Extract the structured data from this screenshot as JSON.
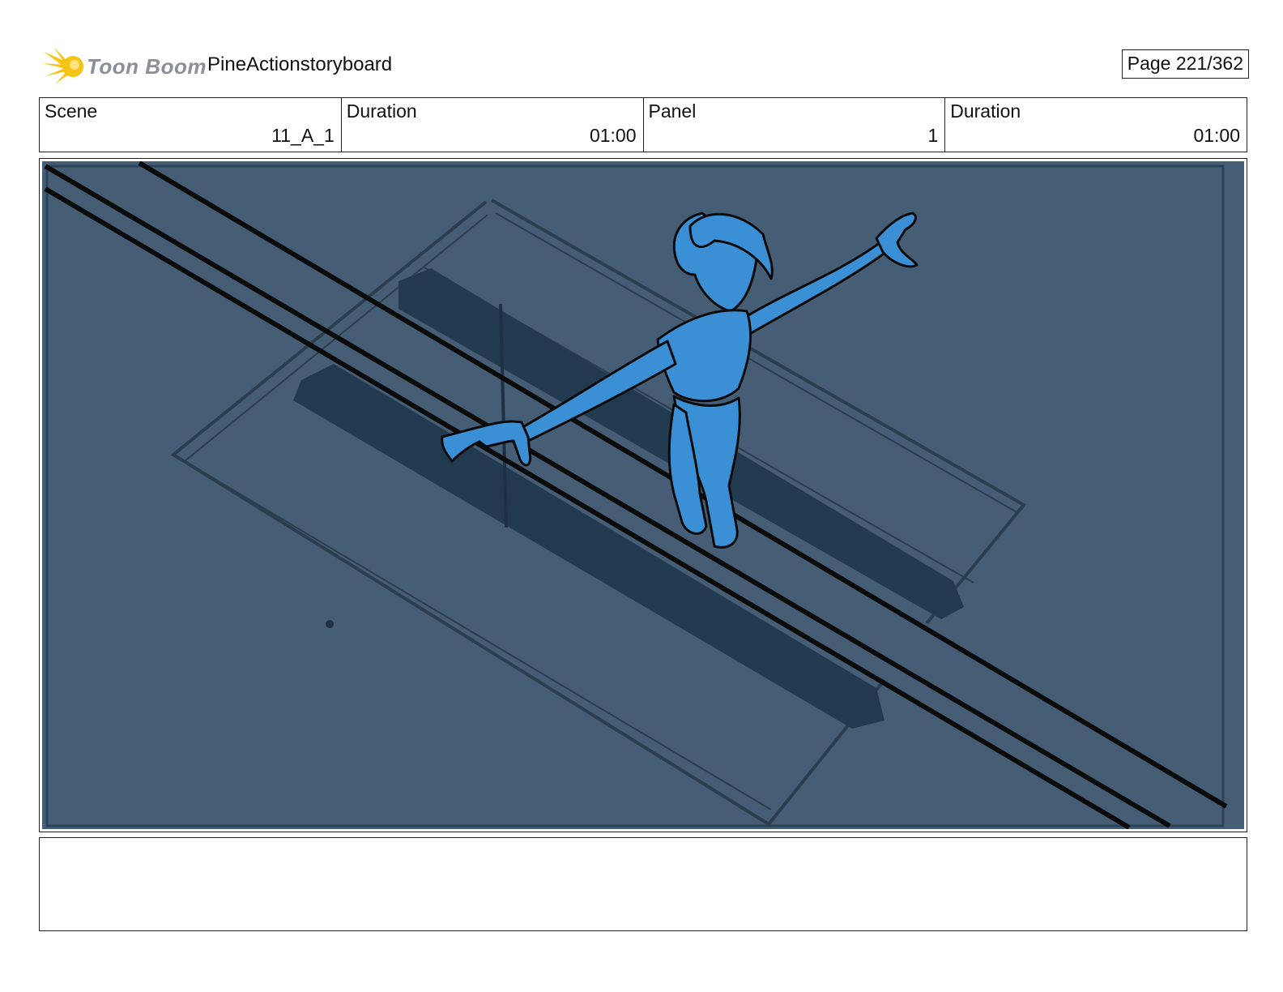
{
  "header": {
    "logo_text": "Toon Boom",
    "project_title": "PineActionstoryboard",
    "page_label": "Page 221/362"
  },
  "info": {
    "scene_label": "Scene",
    "scene_value": "11_A_1",
    "scene_duration_label": "Duration",
    "scene_duration_value": "01:00",
    "panel_label": "Panel",
    "panel_value": "1",
    "panel_duration_label": "Duration",
    "panel_duration_value": "01:00"
  },
  "colors": {
    "panel_bg": "#455e75",
    "shadow": "#223a50",
    "figure": "#3b8fd4",
    "ink": "#0b0b0b",
    "logo_flare": "#f6c416",
    "logo_text": "#8a8f99"
  },
  "notes": {
    "text": ""
  }
}
